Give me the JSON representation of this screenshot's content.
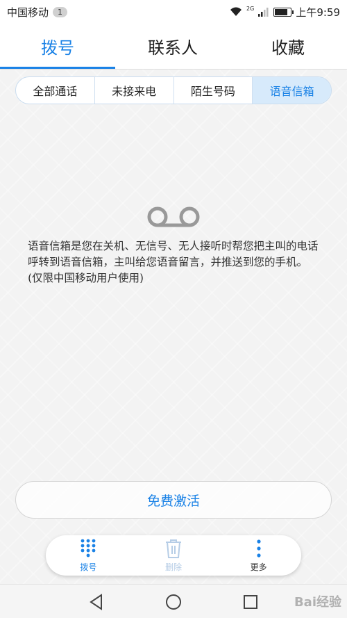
{
  "status_bar": {
    "carrier": "中国移动",
    "badge": "1",
    "network": "2G",
    "time": "上午9:59"
  },
  "tabs": [
    {
      "label": "拨号",
      "active": true
    },
    {
      "label": "联系人",
      "active": false
    },
    {
      "label": "收藏",
      "active": false
    }
  ],
  "segments": [
    {
      "label": "全部通话",
      "active": false
    },
    {
      "label": "未接来电",
      "active": false
    },
    {
      "label": "陌生号码",
      "active": false
    },
    {
      "label": "语音信箱",
      "active": true
    }
  ],
  "voicemail": {
    "icon": "voicemail-icon",
    "description": "语音信箱是您在关机、无信号、无人接听时帮您把主叫的电话呼转到语音信箱，主叫给您语音留言，并推送到您的手机。(仅限中国移动用户使用)"
  },
  "activate_button": "免费激活",
  "actions": {
    "dial": "拨号",
    "delete": "删除",
    "more": "更多"
  },
  "watermark": "Bai经验",
  "colors": {
    "accent": "#1a82e6",
    "segment_active_bg": "#d7eafb",
    "disabled": "#b6cde6"
  }
}
